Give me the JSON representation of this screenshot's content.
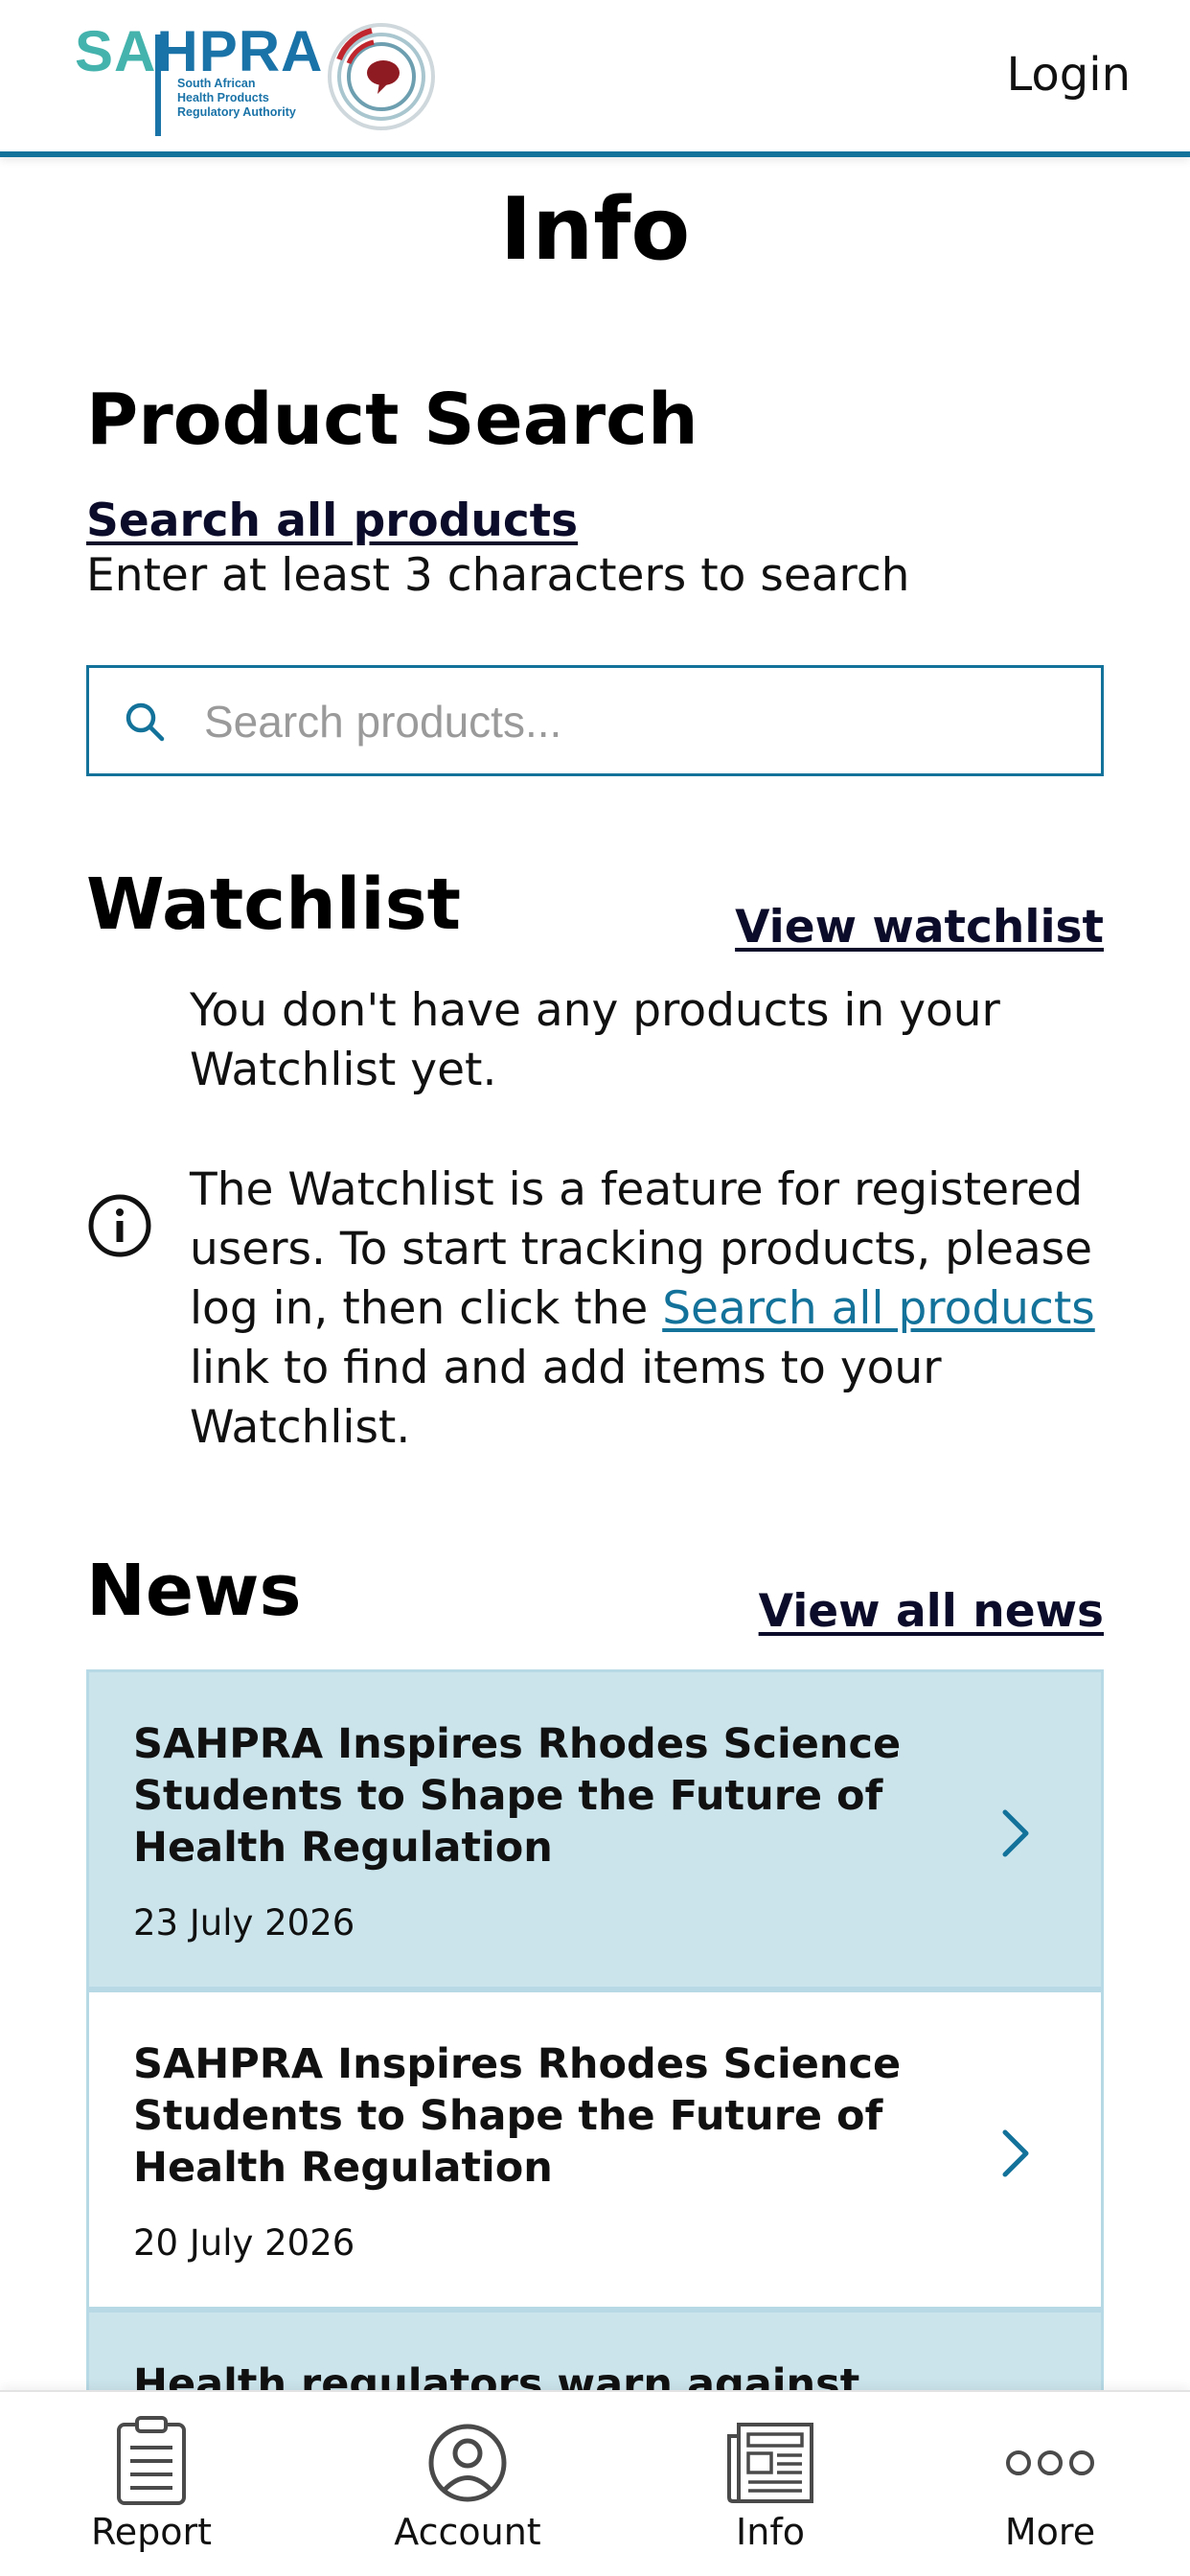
{
  "header": {
    "logo": {
      "brand_left": "SA",
      "brand_right": "HPRA",
      "subtitle_lines": [
        "South African",
        "Health Products",
        "Regulatory Authority"
      ]
    },
    "login_label": "Login"
  },
  "page": {
    "title": "Info"
  },
  "product_search": {
    "title": "Product Search",
    "search_all_link": "Search all products",
    "helper": "Enter at least 3 characters to search",
    "placeholder": "Search products..."
  },
  "watchlist": {
    "title": "Watchlist",
    "view_link": "View watchlist",
    "empty_message": "You don't have any products in your Watchlist yet.",
    "info_before": "The Watchlist is a feature for registered users. To start tracking products, please log in, then click the ",
    "info_link": "Search all products",
    "info_after": " link to find and add items to your Watchlist."
  },
  "news": {
    "title": "News",
    "view_all_link": "View all news",
    "items": [
      {
        "headline": "SAHPRA Inspires Rhodes Science Students to Shape the Future of Health Regulation",
        "date": "23 July 2026"
      },
      {
        "headline": "SAHPRA Inspires Rhodes Science Students to Shape the Future of Health Regulation",
        "date": "20 July 2026"
      },
      {
        "headline": "Health regulators warn against the",
        "date": ""
      }
    ]
  },
  "bottom_nav": {
    "items": [
      {
        "label": "Report",
        "icon": "clipboard-icon"
      },
      {
        "label": "Account",
        "icon": "user-circle-icon"
      },
      {
        "label": "Info",
        "icon": "newspaper-icon"
      },
      {
        "label": "More",
        "icon": "more-dots-icon"
      }
    ]
  },
  "colors": {
    "accent": "#13729a",
    "card_highlight": "#cbe4ec",
    "brand_teal": "#45b3ad",
    "brand_blue": "#1a73a8",
    "emblem_red": "#c0262d"
  }
}
